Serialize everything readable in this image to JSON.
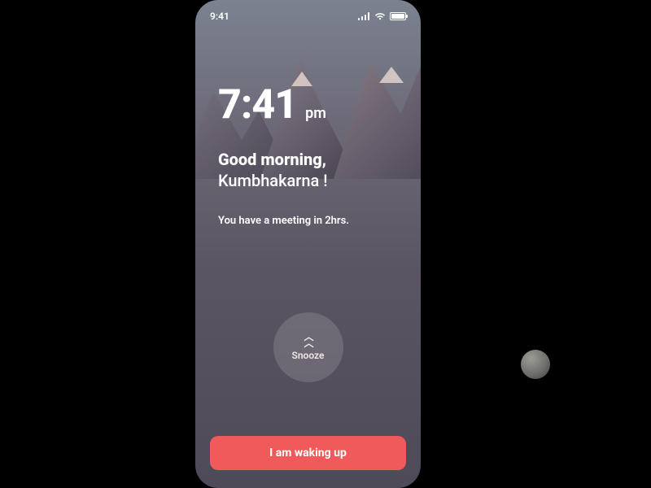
{
  "status_bar": {
    "time": "9:41"
  },
  "clock": {
    "time": "7:41",
    "ampm": "pm"
  },
  "greeting": {
    "line1": "Good morning,",
    "line2": "Kumbhakarna !"
  },
  "meeting_note": "You have a meeting in 2hrs.",
  "snooze": {
    "label": "Snooze",
    "icon": "chevron-up-double"
  },
  "wake_button": {
    "label": "I am waking up"
  },
  "colors": {
    "accent": "#f05a5a"
  }
}
